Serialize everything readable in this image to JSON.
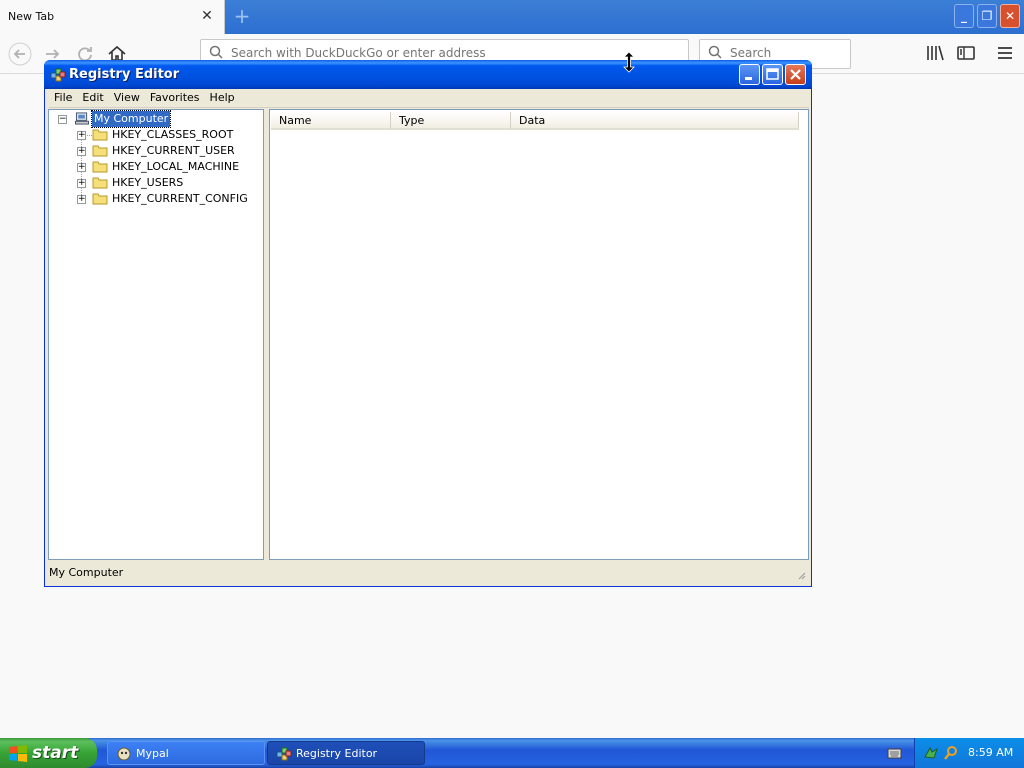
{
  "browser": {
    "tab_title": "New Tab",
    "address_placeholder": "Search with DuckDuckGo or enter address",
    "search_placeholder": "Search"
  },
  "registry_editor": {
    "title": "Registry Editor",
    "menu": [
      "File",
      "Edit",
      "View",
      "Favorites",
      "Help"
    ],
    "tree": {
      "root": "My Computer",
      "keys": [
        "HKEY_CLASSES_ROOT",
        "HKEY_CURRENT_USER",
        "HKEY_LOCAL_MACHINE",
        "HKEY_USERS",
        "HKEY_CURRENT_CONFIG"
      ]
    },
    "columns": [
      "Name",
      "Type",
      "Data"
    ],
    "status": "My Computer"
  },
  "taskbar": {
    "start_label": "start",
    "items": [
      "Mypal",
      "Registry Editor"
    ],
    "clock": "8:59 AM"
  },
  "colors": {
    "xp_blue": "#0058ee",
    "selection": "#316ac5",
    "start_green": "#36a336"
  }
}
